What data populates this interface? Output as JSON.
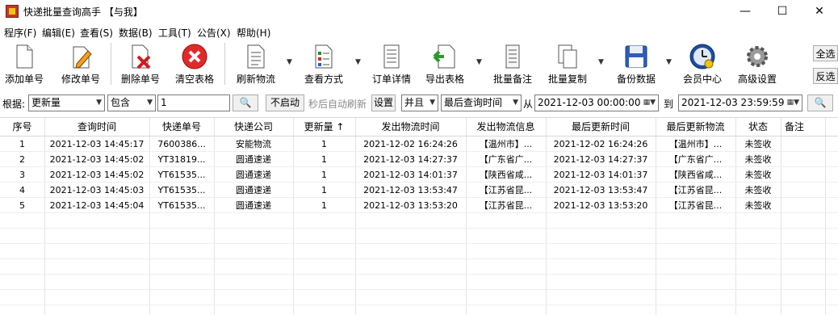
{
  "window": {
    "title": "快递批量查询高手 【与我】",
    "minimize": "—",
    "maximize": "☐",
    "close": "✕"
  },
  "menu": [
    "程序(F)",
    "编辑(E)",
    "查看(S)",
    "数据(B)",
    "工具(T)",
    "公告(X)",
    "帮助(H)"
  ],
  "toolbar": {
    "add": "添加单号",
    "edit": "修改单号",
    "delete": "删除单号",
    "clear": "清空表格",
    "refresh": "刷新物流",
    "view_mode": "查看方式",
    "order_detail": "订单详情",
    "export": "导出表格",
    "batch_note": "批量备注",
    "batch_copy": "批量复制",
    "backup": "备份数据",
    "member": "会员中心",
    "advanced": "高级设置",
    "select_all": "全选",
    "invert": "反选"
  },
  "filter": {
    "by_label": "根据:",
    "field": "更新量",
    "op": "包含",
    "value": "1",
    "auto_refresh_btn": "不启动",
    "auto_refresh_text": "秒后自动刷新",
    "settings_btn": "设置",
    "logic": "并且",
    "time_field": "最后查询时间",
    "from_label": "从",
    "from": "2021-12-03 00:00:00",
    "to_label": "到",
    "to": "2021-12-03 23:59:59"
  },
  "table": {
    "headers": [
      "序号",
      "查询时间",
      "快递单号",
      "快递公司",
      "更新量 ↑",
      "发出物流时间",
      "发出物流信息",
      "最后更新时间",
      "最后更新物流",
      "状态",
      "备注"
    ],
    "rows": [
      [
        "1",
        "2021-12-03 14:45:17",
        "7600386...",
        "安能物流",
        "1",
        "2021-12-02 16:24:26",
        "【温州市】...",
        "2021-12-02 16:24:26",
        "【温州市】...",
        "未签收",
        ""
      ],
      [
        "2",
        "2021-12-03 14:45:02",
        "YT31819...",
        "圆通速递",
        "1",
        "2021-12-03 14:27:37",
        "【广东省广...",
        "2021-12-03 14:27:37",
        "【广东省广...",
        "未签收",
        ""
      ],
      [
        "3",
        "2021-12-03 14:45:02",
        "YT61535...",
        "圆通速递",
        "1",
        "2021-12-03 14:01:37",
        "【陕西省咸...",
        "2021-12-03 14:01:37",
        "【陕西省咸...",
        "未签收",
        ""
      ],
      [
        "4",
        "2021-12-03 14:45:03",
        "YT61535...",
        "圆通速递",
        "1",
        "2021-12-03 13:53:47",
        "【江苏省昆...",
        "2021-12-03 13:53:47",
        "【江苏省昆...",
        "未签收",
        ""
      ],
      [
        "5",
        "2021-12-03 14:45:04",
        "YT61535...",
        "圆通速递",
        "1",
        "2021-12-03 13:53:20",
        "【江苏省昆...",
        "2021-12-03 13:53:20",
        "【江苏省昆...",
        "未签收",
        ""
      ]
    ]
  }
}
